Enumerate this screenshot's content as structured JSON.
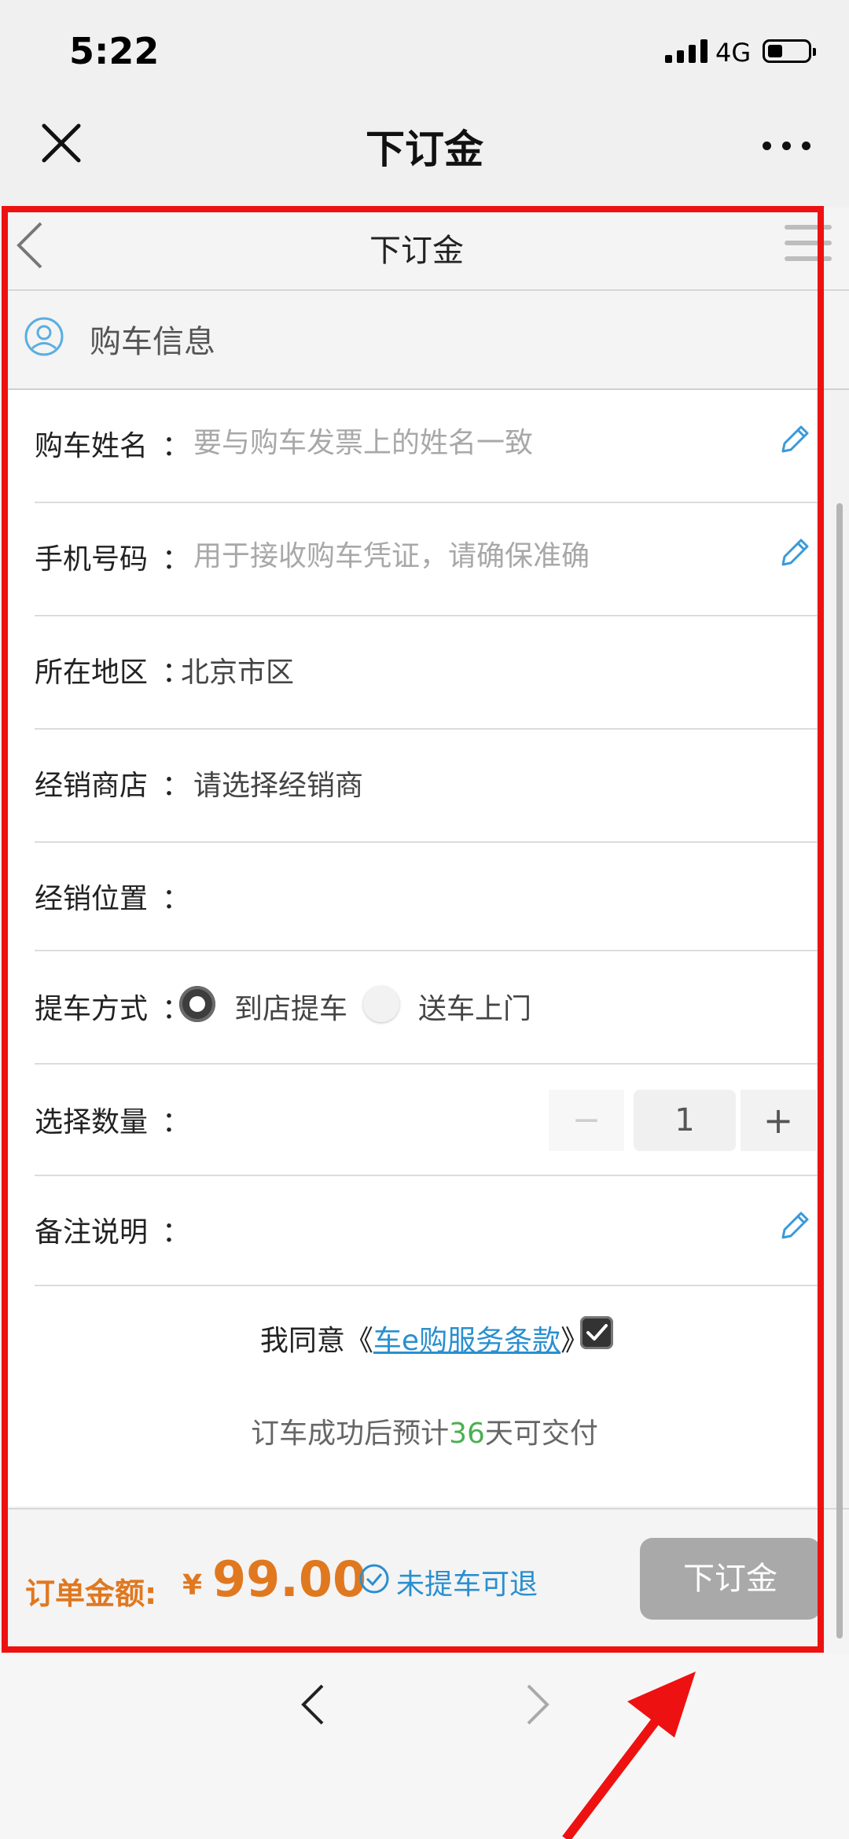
{
  "status_bar": {
    "time": "5:22",
    "network": "4G"
  },
  "header": {
    "title": "下订金"
  },
  "page": {
    "title": "下订金",
    "section_title": "购车信息",
    "form": {
      "name_label": "购车姓名",
      "name_placeholder": "要与购车发票上的姓名一致",
      "phone_label": "手机号码",
      "phone_placeholder": "用于接收购车凭证，请确保准确",
      "region_label": "所在地区",
      "region_value": "北京市区",
      "dealer_label": "经销商店",
      "dealer_value": "请选择经销商",
      "location_label": "经销位置",
      "pickup_label": "提车方式",
      "pickup_options": [
        "到店提车",
        "送车上门"
      ],
      "quantity_label": "选择数量",
      "quantity_value": "1",
      "minus_symbol": "−",
      "plus_symbol": "+",
      "note_label": "备注说明",
      "colon": "："
    },
    "agreement": {
      "prefix": "我同意《",
      "link": "车e购服务条款",
      "suffix": "》",
      "checked": true
    },
    "delivery": {
      "prefix": "订车成功后预计",
      "days": "36",
      "suffix": "天可交付"
    },
    "order": {
      "amount_label": "订单金额:",
      "currency": "¥",
      "amount": "99.00",
      "refund_text": "未提车可退",
      "submit_label": "下订金"
    }
  },
  "colors": {
    "accent_orange": "#e07820",
    "link_blue": "#2a8fd0",
    "highlight_red": "#ee1111",
    "days_green": "#4caf50"
  }
}
